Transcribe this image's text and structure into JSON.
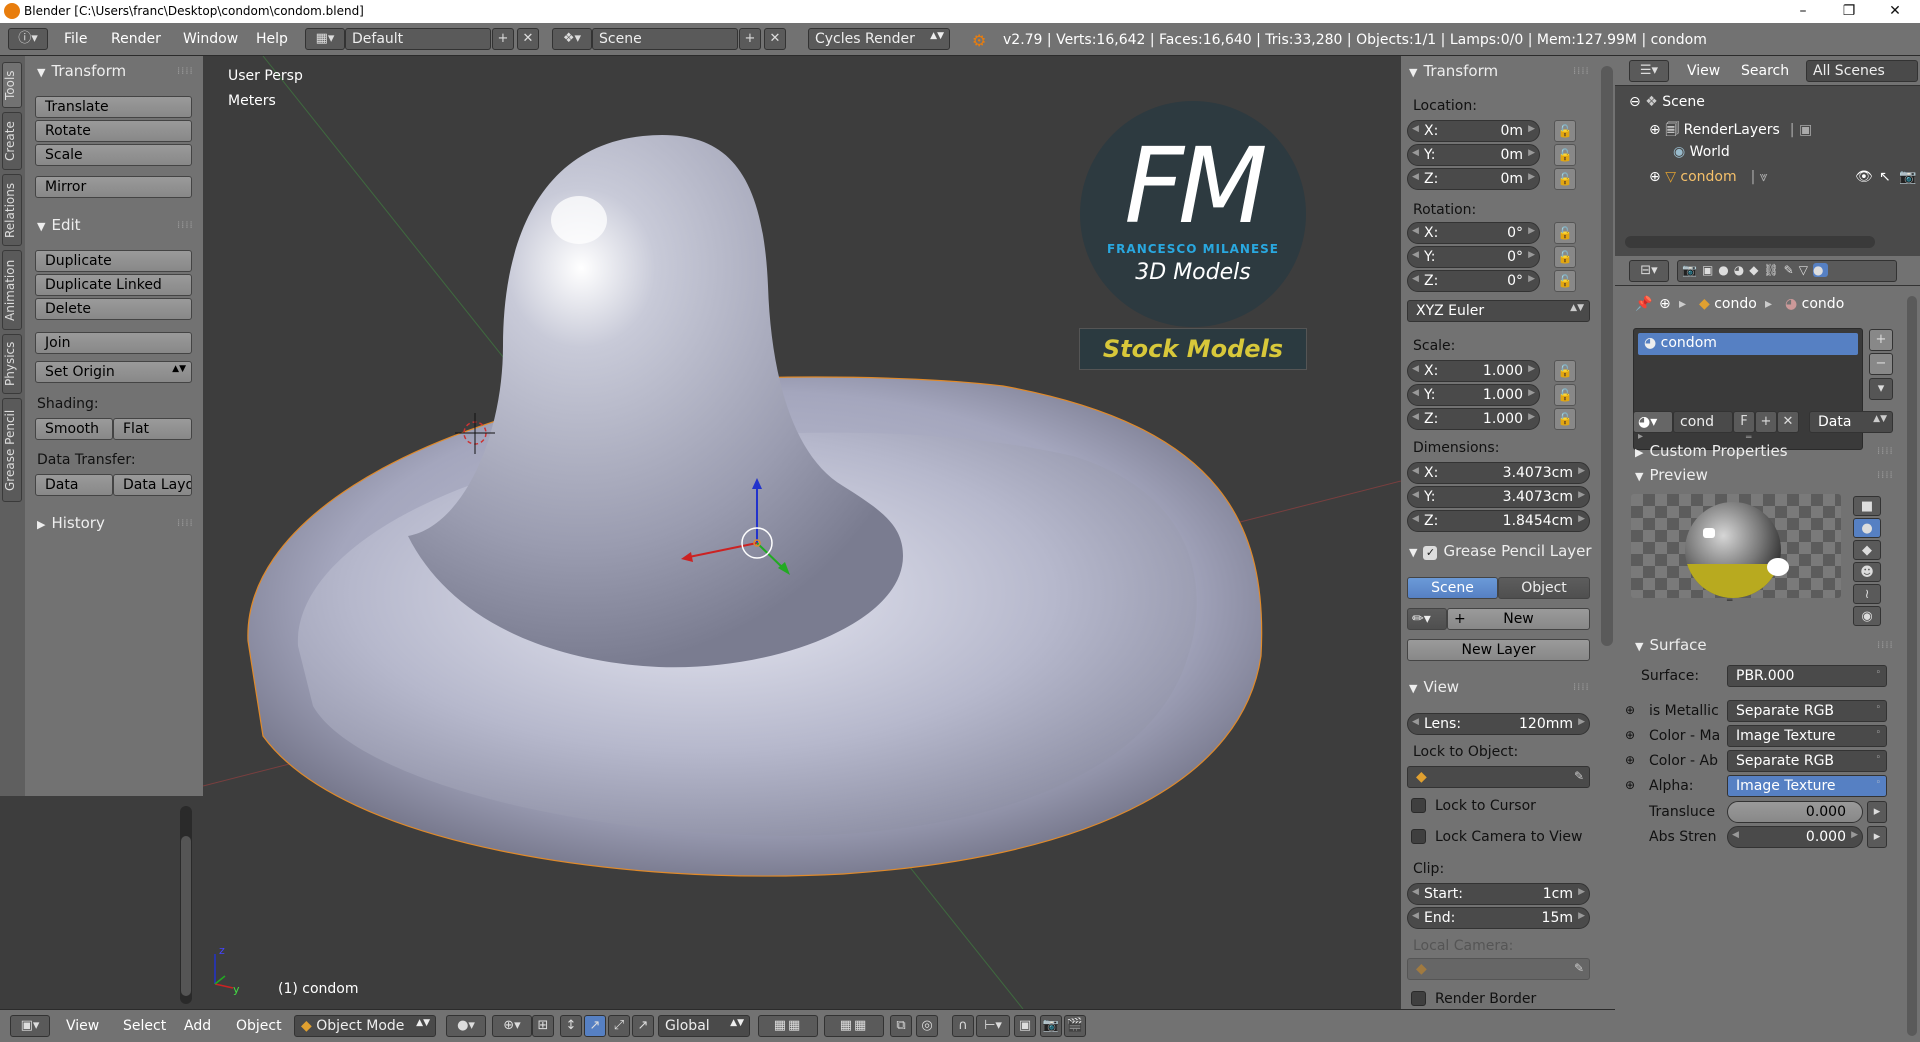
{
  "window": {
    "title": "Blender [C:\\Users\\franc\\Desktop\\condom\\condom.blend]",
    "minimize": "–",
    "maximize": "❐",
    "close": "✕"
  },
  "menu": {
    "file": "File",
    "render": "Render",
    "window": "Window",
    "help": "Help",
    "layout": "Default",
    "scene": "Scene",
    "engine": "Cycles Render",
    "stats": "v2.79 | Verts:16,642 | Faces:16,640 | Tris:33,280 | Objects:1/1 | Lamps:0/0 | Mem:127.99M | condom"
  },
  "tool_tabs": [
    "Tools",
    "Create",
    "Relations",
    "Animation",
    "Physics",
    "Grease Pencil"
  ],
  "tools": {
    "transform_header": "Transform",
    "translate": "Translate",
    "rotate": "Rotate",
    "scale": "Scale",
    "mirror": "Mirror",
    "edit_header": "Edit",
    "duplicate": "Duplicate",
    "duplicate_linked": "Duplicate Linked",
    "delete": "Delete",
    "join": "Join",
    "set_origin": "Set Origin",
    "shading_label": "Shading:",
    "smooth": "Smooth",
    "flat": "Flat",
    "data_transfer_label": "Data Transfer:",
    "data": "Data",
    "data_layout": "Data Layo",
    "history_header": "History"
  },
  "viewport": {
    "view_name": "User Persp",
    "units": "Meters",
    "object_label": "(1) condom",
    "watermark": {
      "letters": "FM",
      "name": "FRANCESCO MILANESE",
      "subtitle": "3D Models",
      "banner": "Stock Models"
    }
  },
  "properties_n": {
    "transform_header": "Transform",
    "location_label": "Location:",
    "location": [
      {
        "k": "X:",
        "v": "0m"
      },
      {
        "k": "Y:",
        "v": "0m"
      },
      {
        "k": "Z:",
        "v": "0m"
      }
    ],
    "rotation_label": "Rotation:",
    "rotation": [
      {
        "k": "X:",
        "v": "0°"
      },
      {
        "k": "Y:",
        "v": "0°"
      },
      {
        "k": "Z:",
        "v": "0°"
      }
    ],
    "rotation_mode": "XYZ Euler",
    "scale_label": "Scale:",
    "scale": [
      {
        "k": "X:",
        "v": "1.000"
      },
      {
        "k": "Y:",
        "v": "1.000"
      },
      {
        "k": "Z:",
        "v": "1.000"
      }
    ],
    "dimensions_label": "Dimensions:",
    "dimensions": [
      {
        "k": "X:",
        "v": "3.4073cm"
      },
      {
        "k": "Y:",
        "v": "3.4073cm"
      },
      {
        "k": "Z:",
        "v": "1.8454cm"
      }
    ],
    "grease_header": "Grease Pencil Layer",
    "scene_btn": "Scene",
    "object_btn": "Object",
    "new_btn": "New",
    "new_layer": "New Layer",
    "view_header": "View",
    "lens_label": "Lens:",
    "lens_value": "120mm",
    "lock_to_object": "Lock to Object:",
    "lock_to_cursor": "Lock to Cursor",
    "lock_camera": "Lock Camera to View",
    "clip_label": "Clip:",
    "clip_start_k": "Start:",
    "clip_start_v": "1cm",
    "clip_end_k": "End:",
    "clip_end_v": "15m",
    "local_camera": "Local Camera:",
    "render_border": "Render Border"
  },
  "outliner": {
    "view": "View",
    "search": "Search",
    "all_scenes": "All Scenes",
    "scene": "Scene",
    "render_layers": "RenderLayers",
    "world": "World",
    "object": "condom"
  },
  "material": {
    "breadcrumb_1": "condo",
    "breadcrumb_2": "condo",
    "slot": "condom",
    "mat_name": "cond",
    "fake_user": "F",
    "data_link": "Data",
    "custom_props": "Custom Properties",
    "preview_header": "Preview",
    "surface_header": "Surface",
    "surface_label": "Surface:",
    "surface_value": "PBR.000",
    "inputs": [
      {
        "label": "is Metallic",
        "value": "Separate RGB"
      },
      {
        "label": "Color - Ma",
        "value": "Image Texture"
      },
      {
        "label": "Color - Ab",
        "value": "Separate RGB"
      },
      {
        "label": "Alpha:",
        "value": "Image Texture"
      }
    ],
    "translucence_label": "Transluce",
    "translucence_value": "0.000",
    "abs_label": "Abs Stren",
    "abs_value": "0.000"
  },
  "bottom": {
    "view": "View",
    "select": "Select",
    "add": "Add",
    "object": "Object",
    "mode": "Object Mode",
    "orientation": "Global"
  }
}
